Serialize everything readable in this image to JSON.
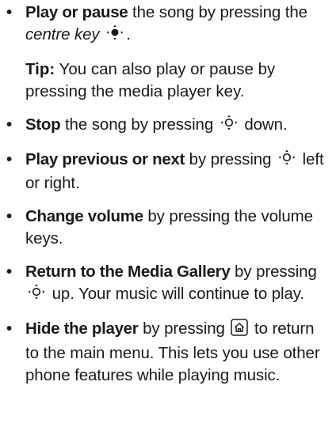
{
  "items": [
    {
      "lead": "Play or pause",
      "text1": " the song by pressing the ",
      "italic": "centre key",
      "text2": "."
    },
    {
      "tip_label": "Tip:",
      "tip_text": " You can also play or pause by pressing the media player key."
    },
    {
      "lead": "Stop",
      "text1": " the song by pressing ",
      "text2": " down."
    },
    {
      "lead": "Play previous or next",
      "text1": " by pressing ",
      "text2": " left or right."
    },
    {
      "lead": "Change volume",
      "text1": " by pressing the volume keys."
    },
    {
      "lead": "Return to the Media Gallery",
      "text1": " by pressing ",
      "text2": " up. Your music will continue to play."
    },
    {
      "lead": "Hide the player",
      "text1": " by pressing ",
      "text2": " to return to the main menu. This lets you use other phone features while playing music."
    }
  ],
  "bullet_char": "•",
  "icons": {
    "centre_key": "nav-key-centre-icon",
    "nav_key": "nav-key-icon",
    "home_key": "home-key-icon"
  }
}
